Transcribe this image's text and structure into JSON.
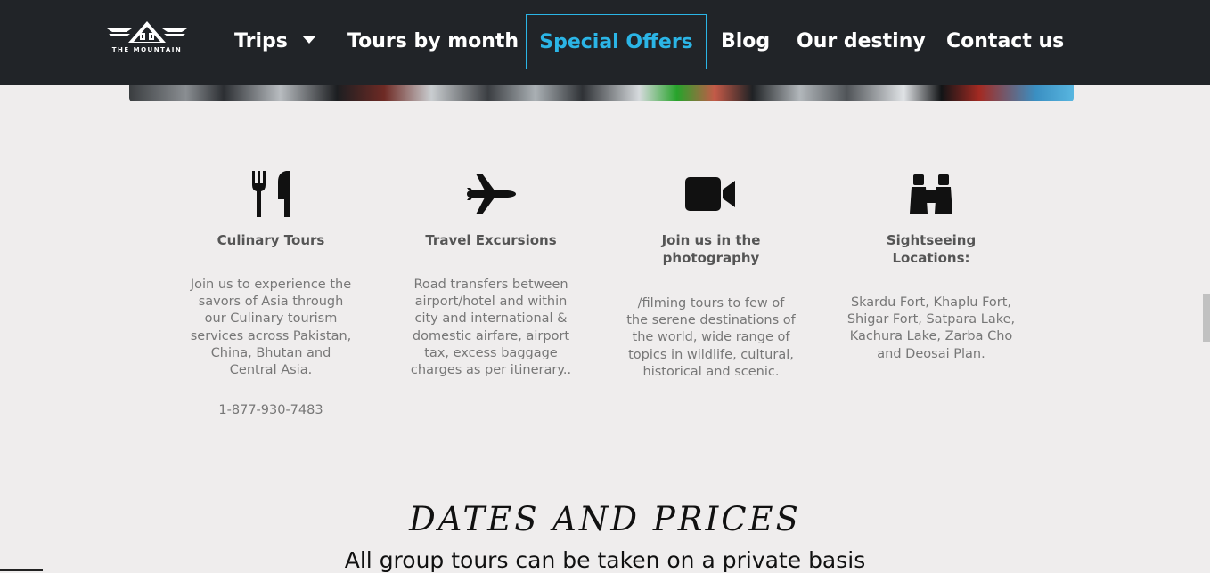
{
  "brand": {
    "logo_text": "THE MOUNTAIN"
  },
  "nav": {
    "items": [
      {
        "label": "Trips"
      },
      {
        "label": "Tours by month"
      },
      {
        "label": "Special Offers"
      },
      {
        "label": "Blog"
      },
      {
        "label": "Our destiny"
      },
      {
        "label": "Contact us"
      }
    ]
  },
  "features": [
    {
      "icon": "utensils-icon",
      "title": "Culinary Tours",
      "description": "Join us to experience the savors of Asia through our Culinary tourism services across Pakistan, China, Bhutan and Central Asia.",
      "phone": "1-877-930-7483"
    },
    {
      "icon": "plane-icon",
      "title": "Travel Excursions",
      "description": "Road transfers between airport/hotel and within city and international & domestic airfare, airport tax, excess baggage charges as per itinerary.."
    },
    {
      "icon": "video-camera-icon",
      "title": "Join us in the photography",
      "description": "/filming tours to few of the serene destinations of the world, wide range of topics in wildlife, cultural, historical and scenic."
    },
    {
      "icon": "binoculars-icon",
      "title": "Sightseeing Locations:",
      "description": "Skardu Fort, Khaplu Fort, Shigar Fort, Satpara Lake, Kachura Lake, Zarba Cho and Deosai Plan."
    }
  ],
  "section": {
    "title": "DATES AND PRICES",
    "subtitle": "All group tours can be taken on a private basis"
  },
  "colors": {
    "navbar_bg": "#212428",
    "accent": "#2bb5e6",
    "page_bg": "#efeded"
  }
}
